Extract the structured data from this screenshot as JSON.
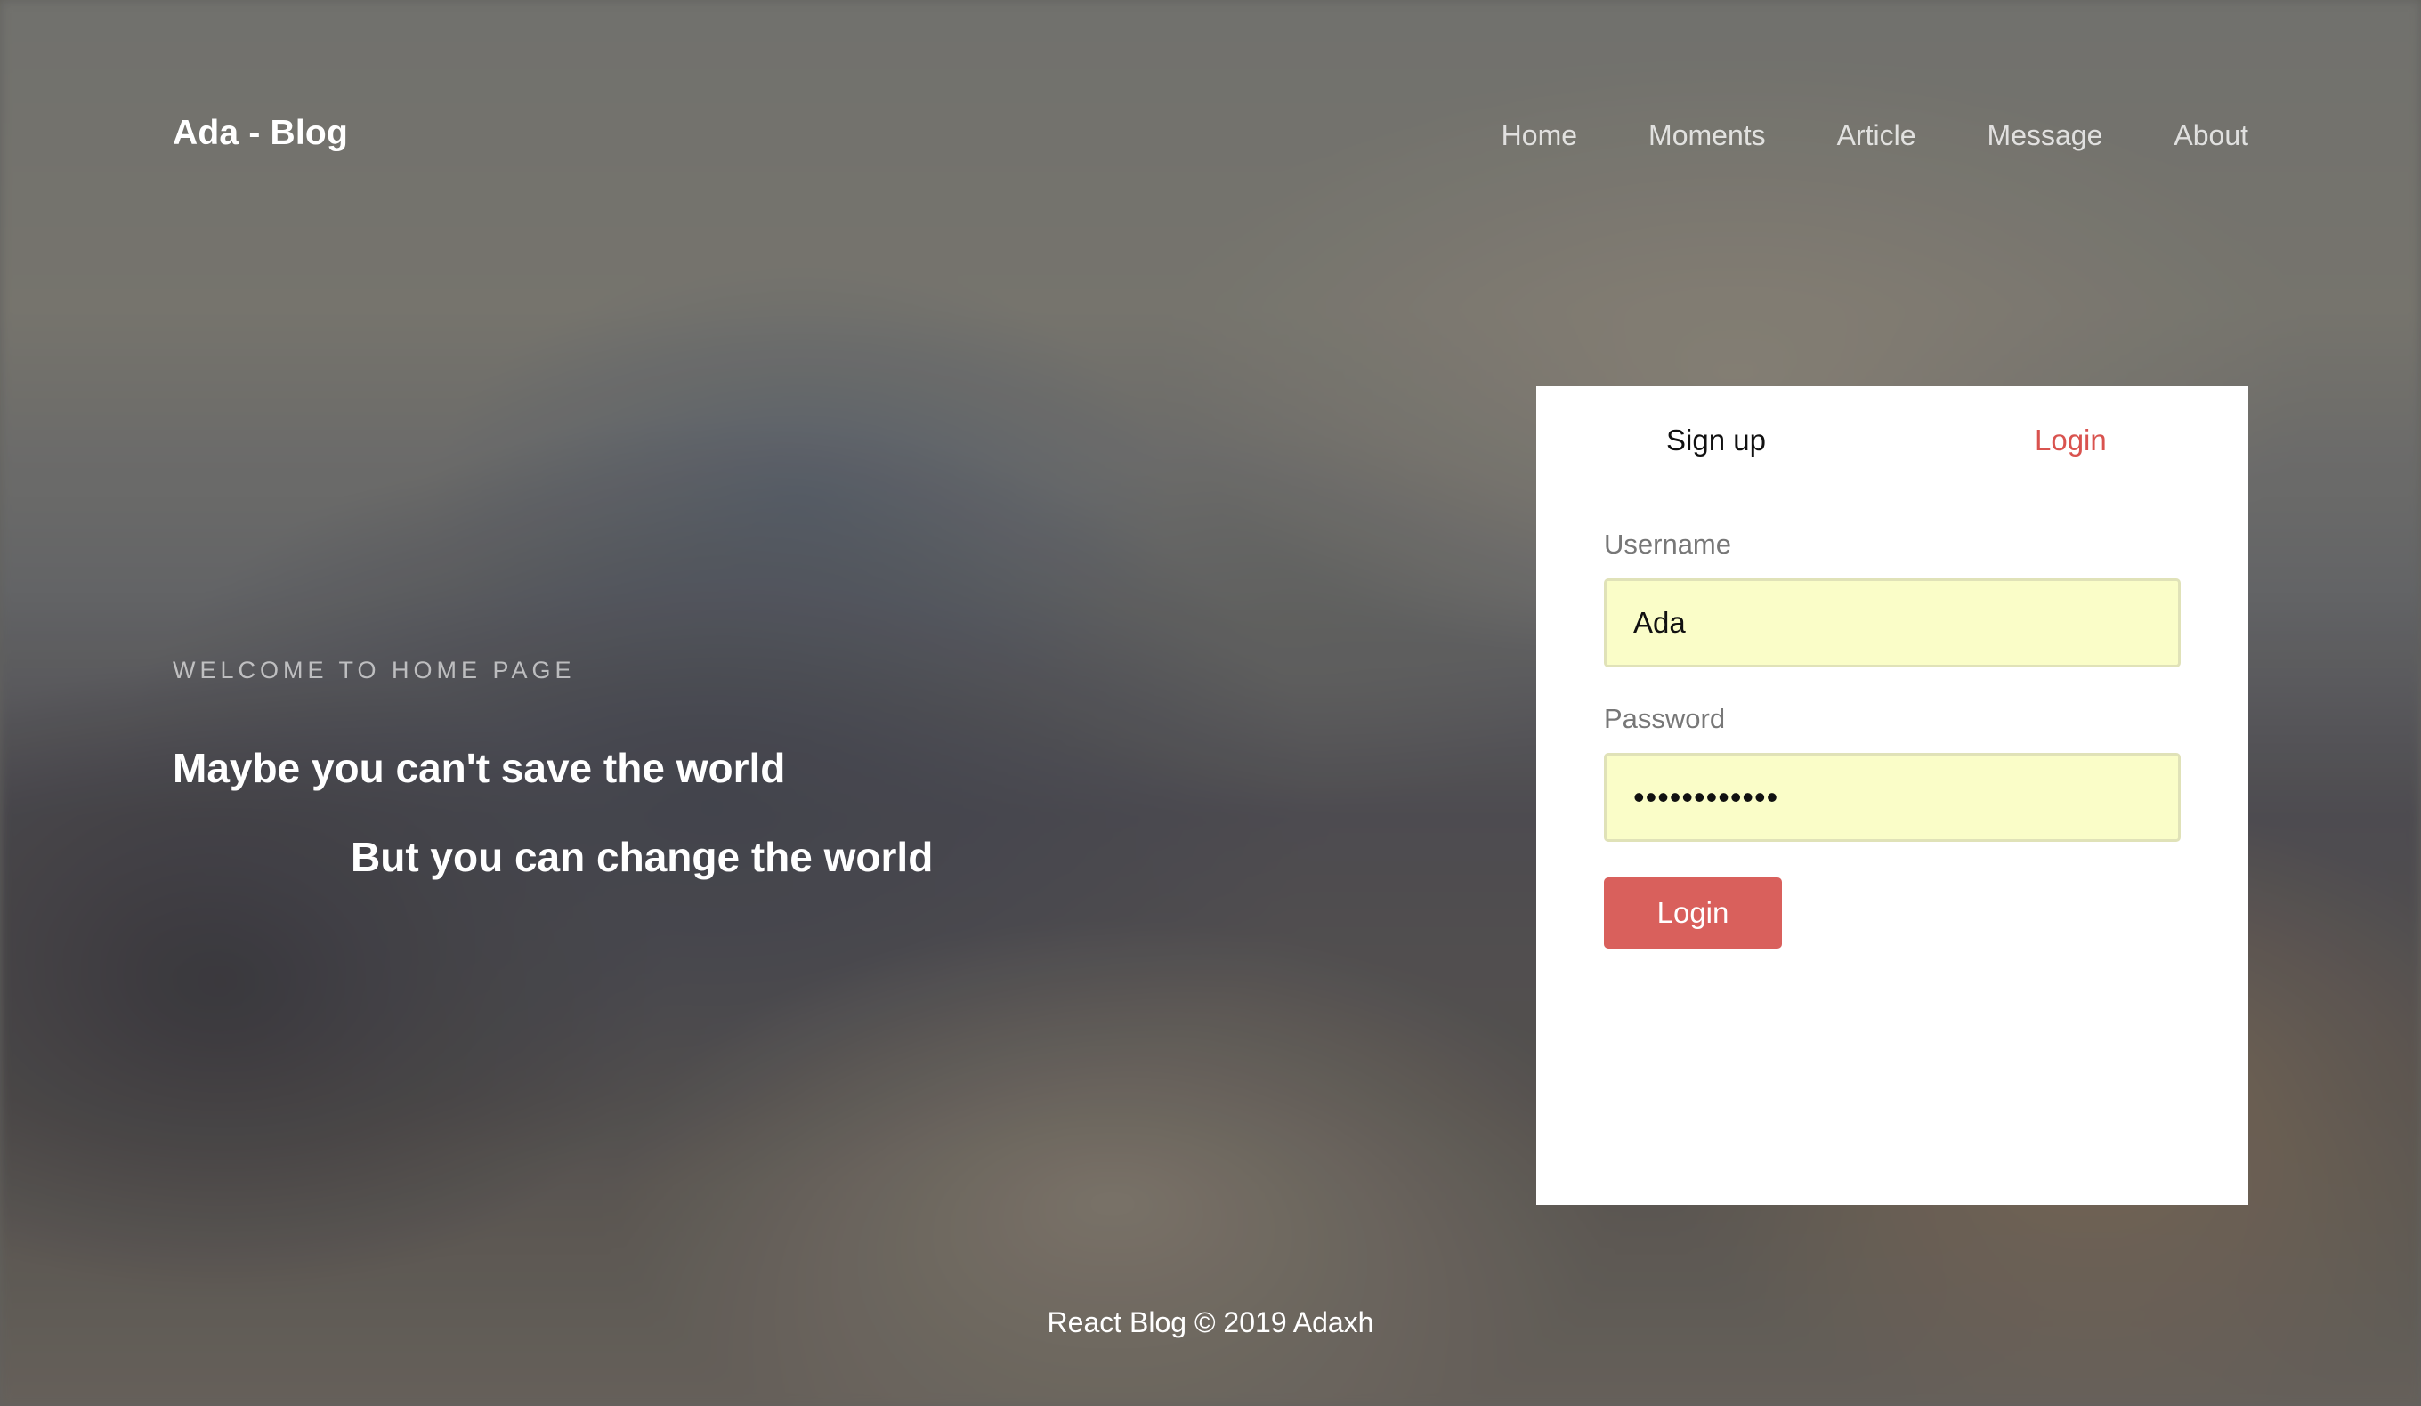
{
  "header": {
    "brand": "Ada - Blog",
    "nav": [
      "Home",
      "Moments",
      "Article",
      "Message",
      "About"
    ]
  },
  "hero": {
    "welcome": "WELCOME TO HOME PAGE",
    "line1": "Maybe you can't save the world",
    "line2": "But you can change the world"
  },
  "login_card": {
    "tabs": {
      "signup": "Sign up",
      "login": "Login",
      "active": "Login"
    },
    "username_label": "Username",
    "username_value": "Ada",
    "password_label": "Password",
    "password_value": "............",
    "submit_label": "Login"
  },
  "footer": {
    "text": "React Blog © 2019 Adaxh"
  },
  "colors": {
    "accent": "#d9605c",
    "autofill_bg": "#fafdc8"
  }
}
